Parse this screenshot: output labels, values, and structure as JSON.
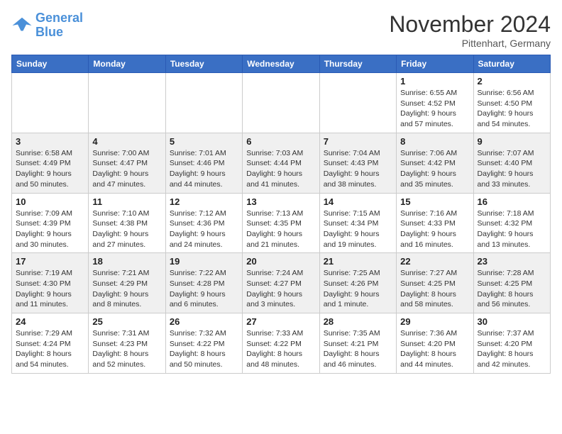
{
  "header": {
    "logo_line1": "General",
    "logo_line2": "Blue",
    "month_title": "November 2024",
    "location": "Pittenhart, Germany"
  },
  "days_of_week": [
    "Sunday",
    "Monday",
    "Tuesday",
    "Wednesday",
    "Thursday",
    "Friday",
    "Saturday"
  ],
  "weeks": [
    [
      {
        "day": "",
        "detail": ""
      },
      {
        "day": "",
        "detail": ""
      },
      {
        "day": "",
        "detail": ""
      },
      {
        "day": "",
        "detail": ""
      },
      {
        "day": "",
        "detail": ""
      },
      {
        "day": "1",
        "detail": "Sunrise: 6:55 AM\nSunset: 4:52 PM\nDaylight: 9 hours and 57 minutes."
      },
      {
        "day": "2",
        "detail": "Sunrise: 6:56 AM\nSunset: 4:50 PM\nDaylight: 9 hours and 54 minutes."
      }
    ],
    [
      {
        "day": "3",
        "detail": "Sunrise: 6:58 AM\nSunset: 4:49 PM\nDaylight: 9 hours and 50 minutes."
      },
      {
        "day": "4",
        "detail": "Sunrise: 7:00 AM\nSunset: 4:47 PM\nDaylight: 9 hours and 47 minutes."
      },
      {
        "day": "5",
        "detail": "Sunrise: 7:01 AM\nSunset: 4:46 PM\nDaylight: 9 hours and 44 minutes."
      },
      {
        "day": "6",
        "detail": "Sunrise: 7:03 AM\nSunset: 4:44 PM\nDaylight: 9 hours and 41 minutes."
      },
      {
        "day": "7",
        "detail": "Sunrise: 7:04 AM\nSunset: 4:43 PM\nDaylight: 9 hours and 38 minutes."
      },
      {
        "day": "8",
        "detail": "Sunrise: 7:06 AM\nSunset: 4:42 PM\nDaylight: 9 hours and 35 minutes."
      },
      {
        "day": "9",
        "detail": "Sunrise: 7:07 AM\nSunset: 4:40 PM\nDaylight: 9 hours and 33 minutes."
      }
    ],
    [
      {
        "day": "10",
        "detail": "Sunrise: 7:09 AM\nSunset: 4:39 PM\nDaylight: 9 hours and 30 minutes."
      },
      {
        "day": "11",
        "detail": "Sunrise: 7:10 AM\nSunset: 4:38 PM\nDaylight: 9 hours and 27 minutes."
      },
      {
        "day": "12",
        "detail": "Sunrise: 7:12 AM\nSunset: 4:36 PM\nDaylight: 9 hours and 24 minutes."
      },
      {
        "day": "13",
        "detail": "Sunrise: 7:13 AM\nSunset: 4:35 PM\nDaylight: 9 hours and 21 minutes."
      },
      {
        "day": "14",
        "detail": "Sunrise: 7:15 AM\nSunset: 4:34 PM\nDaylight: 9 hours and 19 minutes."
      },
      {
        "day": "15",
        "detail": "Sunrise: 7:16 AM\nSunset: 4:33 PM\nDaylight: 9 hours and 16 minutes."
      },
      {
        "day": "16",
        "detail": "Sunrise: 7:18 AM\nSunset: 4:32 PM\nDaylight: 9 hours and 13 minutes."
      }
    ],
    [
      {
        "day": "17",
        "detail": "Sunrise: 7:19 AM\nSunset: 4:30 PM\nDaylight: 9 hours and 11 minutes."
      },
      {
        "day": "18",
        "detail": "Sunrise: 7:21 AM\nSunset: 4:29 PM\nDaylight: 9 hours and 8 minutes."
      },
      {
        "day": "19",
        "detail": "Sunrise: 7:22 AM\nSunset: 4:28 PM\nDaylight: 9 hours and 6 minutes."
      },
      {
        "day": "20",
        "detail": "Sunrise: 7:24 AM\nSunset: 4:27 PM\nDaylight: 9 hours and 3 minutes."
      },
      {
        "day": "21",
        "detail": "Sunrise: 7:25 AM\nSunset: 4:26 PM\nDaylight: 9 hours and 1 minute."
      },
      {
        "day": "22",
        "detail": "Sunrise: 7:27 AM\nSunset: 4:25 PM\nDaylight: 8 hours and 58 minutes."
      },
      {
        "day": "23",
        "detail": "Sunrise: 7:28 AM\nSunset: 4:25 PM\nDaylight: 8 hours and 56 minutes."
      }
    ],
    [
      {
        "day": "24",
        "detail": "Sunrise: 7:29 AM\nSunset: 4:24 PM\nDaylight: 8 hours and 54 minutes."
      },
      {
        "day": "25",
        "detail": "Sunrise: 7:31 AM\nSunset: 4:23 PM\nDaylight: 8 hours and 52 minutes."
      },
      {
        "day": "26",
        "detail": "Sunrise: 7:32 AM\nSunset: 4:22 PM\nDaylight: 8 hours and 50 minutes."
      },
      {
        "day": "27",
        "detail": "Sunrise: 7:33 AM\nSunset: 4:22 PM\nDaylight: 8 hours and 48 minutes."
      },
      {
        "day": "28",
        "detail": "Sunrise: 7:35 AM\nSunset: 4:21 PM\nDaylight: 8 hours and 46 minutes."
      },
      {
        "day": "29",
        "detail": "Sunrise: 7:36 AM\nSunset: 4:20 PM\nDaylight: 8 hours and 44 minutes."
      },
      {
        "day": "30",
        "detail": "Sunrise: 7:37 AM\nSunset: 4:20 PM\nDaylight: 8 hours and 42 minutes."
      }
    ]
  ]
}
